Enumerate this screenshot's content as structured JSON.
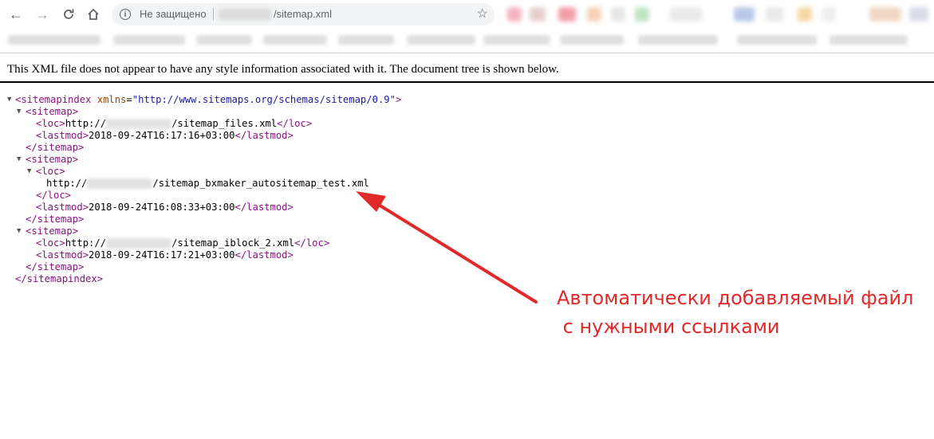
{
  "browser": {
    "security_label": "Не защищено",
    "url_path": "/sitemap.xml",
    "back_icon": "back-arrow-icon",
    "forward_icon": "forward-arrow-icon",
    "reload_icon": "reload-icon",
    "home_icon": "home-icon",
    "star_icon": "bookmark-star-icon"
  },
  "notice": "This XML file does not appear to have any style information associated with it. The document tree is shown below.",
  "xml": {
    "root_open": "<sitemapindex",
    "root_attr": "xmlns",
    "root_attr_value": "\"http://www.sitemaps.org/schemas/sitemap/0.9\"",
    "root_open_end": ">",
    "root_close": "</sitemapindex>",
    "sitemap_open": "<sitemap>",
    "sitemap_close": "</sitemap>",
    "loc_open": "<loc>",
    "loc_close": "</loc>",
    "lastmod_open": "<lastmod>",
    "lastmod_close": "</lastmod>",
    "url_prefix": "http://",
    "entries": [
      {
        "loc_path": "/sitemap_files.xml",
        "lastmod": "2018-09-24T16:17:16+03:00"
      },
      {
        "loc_path": "/sitemap_bxmaker_autositemap_test.xml",
        "lastmod": "2018-09-24T16:08:33+03:00"
      },
      {
        "loc_path": "/sitemap_iblock_2.xml",
        "lastmod": "2018-09-24T16:17:21+03:00"
      }
    ]
  },
  "annotation": {
    "line1": "Автоматически добавляемый файл",
    "line2": " с нужными ссылками",
    "color": "#e02a2a"
  }
}
